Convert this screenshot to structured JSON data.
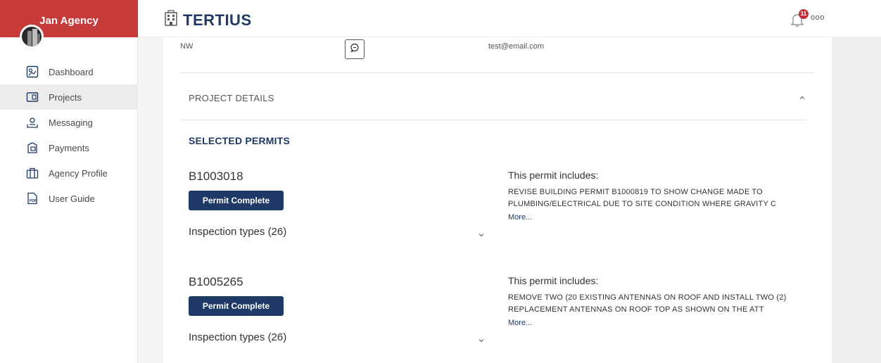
{
  "sidebar": {
    "agency_name": "Jan Agency",
    "items": [
      {
        "label": "Dashboard"
      },
      {
        "label": "Projects"
      },
      {
        "label": "Messaging"
      },
      {
        "label": "Payments"
      },
      {
        "label": "Agency Profile"
      },
      {
        "label": "User Guide"
      }
    ],
    "active_item": "Projects"
  },
  "header": {
    "logo_text": "TERTIUS",
    "notification_count": "11",
    "more_label": "ooo"
  },
  "contact": {
    "address_fragment": "NW",
    "email": "test@email.com"
  },
  "project_details": {
    "title": "PROJECT DETAILS"
  },
  "permits_section": {
    "title": "SELECTED PERMITS",
    "permits": [
      {
        "id": "B1003018",
        "status": "Permit Complete",
        "inspection_label": "Inspection types (26)",
        "includes_title": "This permit includes:",
        "description": "REVISE BUILDING PERMIT B1000819 TO SHOW CHANGE MADE TO PLUMBING/ELECTRICAL DUE TO SITE CONDITION WHERE GRAVITY C",
        "more_label": "More..."
      },
      {
        "id": "B1005265",
        "status": "Permit Complete",
        "inspection_label": "Inspection types (26)",
        "includes_title": "This permit includes:",
        "description": "REMOVE TWO (20 EXISTING ANTENNAS ON ROOF AND INSTALL TWO (2) REPLACEMENT ANTENNAS ON ROOF TOP AS SHOWN ON THE ATT",
        "more_label": "More..."
      }
    ]
  },
  "colors": {
    "brand_red": "#c73a3a",
    "navy": "#1f3a66",
    "badge_red": "#c0313c"
  }
}
